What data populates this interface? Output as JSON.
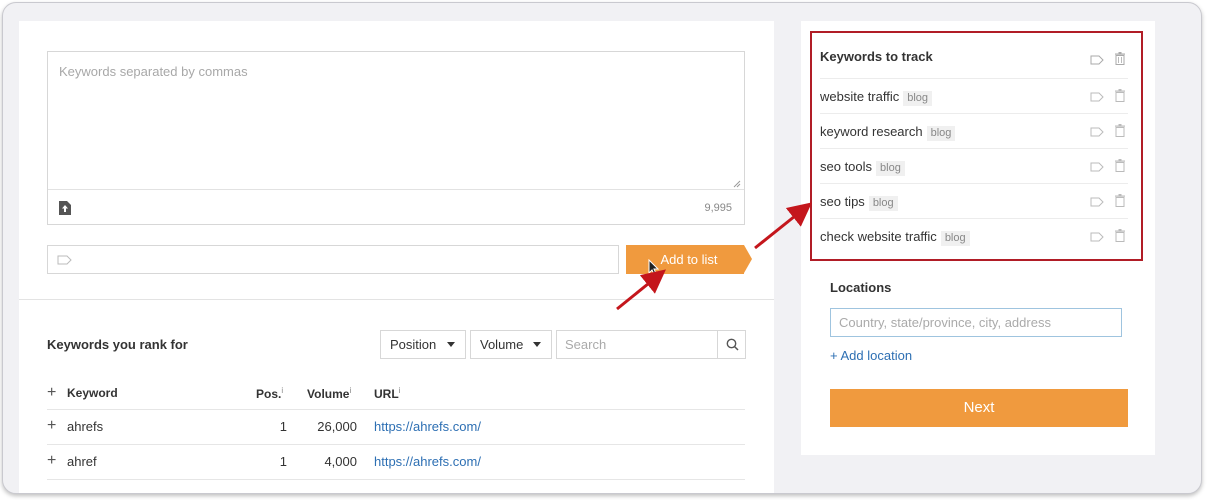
{
  "keywords_input": {
    "placeholder": "Keywords separated by commas",
    "char_count": "9,995"
  },
  "add_button_label": "Add to list",
  "rank_section": {
    "title": "Keywords you rank for",
    "position_dropdown": "Position",
    "volume_dropdown": "Volume",
    "search_placeholder": "Search",
    "headers": {
      "keyword": "Keyword",
      "pos": "Pos.",
      "volume": "Volume",
      "url": "URL",
      "info_mark": "i"
    },
    "rows": [
      {
        "keyword": "ahrefs",
        "pos": "1",
        "volume": "26,000",
        "url": "https://ahrefs.com/"
      },
      {
        "keyword": "ahref",
        "pos": "1",
        "volume": "4,000",
        "url": "https://ahrefs.com/"
      }
    ]
  },
  "track_panel": {
    "title": "Keywords to track",
    "items": [
      {
        "keyword": "website traffic",
        "tag": "blog"
      },
      {
        "keyword": "keyword research",
        "tag": "blog"
      },
      {
        "keyword": "seo tools",
        "tag": "blog"
      },
      {
        "keyword": "seo tips",
        "tag": "blog"
      },
      {
        "keyword": "check website traffic",
        "tag": "blog"
      }
    ]
  },
  "locations": {
    "title": "Locations",
    "placeholder": "Country, state/province, city, address",
    "add_label": "Add location"
  },
  "next_label": "Next",
  "colors": {
    "accent_orange": "#f09a3e",
    "highlight_red": "#b11d26",
    "link_blue": "#2d6fb3"
  },
  "icons": [
    "upload-icon",
    "tag-icon",
    "trash-icon",
    "search-icon",
    "caret-down-icon",
    "plus-icon",
    "cursor-icon",
    "arrow-annotation"
  ]
}
